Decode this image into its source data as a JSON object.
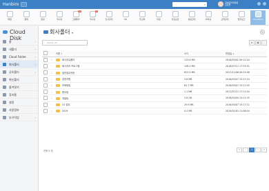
{
  "app": {
    "brand": "Hanbiro",
    "search_placeholder": "",
    "user_line1": "한비로마케팅팀",
    "user_line2": "김상철",
    "accent": "#3b7fc4"
  },
  "apps": [
    {
      "name": "app-mail",
      "label": "메일",
      "badge": ""
    },
    {
      "name": "app-approval",
      "label": "결재",
      "badge": ""
    },
    {
      "name": "app-calendar",
      "label": "일정",
      "badge": ""
    },
    {
      "name": "app-board",
      "label": "게시판",
      "badge": ""
    },
    {
      "name": "app-groupware",
      "label": "그룹웨어",
      "badge": "11"
    },
    {
      "name": "app-board2",
      "label": "게시판",
      "badge": "8"
    },
    {
      "name": "app-address",
      "label": "인사관리",
      "badge": ""
    },
    {
      "name": "app-hr",
      "label": "HR",
      "badge": ""
    },
    {
      "name": "app-task",
      "label": "주소록",
      "badge": ""
    },
    {
      "name": "app-meeting",
      "label": "미팅",
      "badge": ""
    },
    {
      "name": "app-archive",
      "label": "자료보관",
      "badge": ""
    },
    {
      "name": "app-survey",
      "label": "설문관리",
      "badge": ""
    },
    {
      "name": "app-reserve",
      "label": "회의실",
      "badge": ""
    },
    {
      "name": "app-timecard",
      "label": "근태관리",
      "badge": ""
    },
    {
      "name": "app-memo",
      "label": "업무보고",
      "badge": ""
    },
    {
      "name": "app-clouddisk",
      "label": "CloudDisk",
      "badge": ""
    }
  ],
  "sidebar": {
    "title": "Cloud Disk",
    "items": [
      {
        "label": "홈",
        "has_arrow": true
      },
      {
        "label": "내폴더",
        "has_arrow": true
      },
      {
        "label": "Cloud Folder",
        "has_arrow": true
      },
      {
        "label": "회사폴더",
        "has_arrow": true
      },
      {
        "label": "공유폴더",
        "has_arrow": true
      },
      {
        "label": "최신폴더",
        "has_arrow": false
      },
      {
        "label": "즐겨찾기",
        "has_arrow": false
      },
      {
        "label": "휴지통",
        "has_arrow": false
      },
      {
        "label": "설정",
        "has_arrow": false
      },
      {
        "label": "사용정보",
        "has_arrow": false
      },
      {
        "label": "부가작업",
        "has_arrow": true
      }
    ]
  },
  "main": {
    "title": "회사폴더",
    "search_placeholder": "Search All",
    "toolbar_icons": [
      "list-view",
      "grid-view",
      "menu"
    ],
    "columns": {
      "name": "이름 ↑",
      "size": "크기",
      "date": "변경일 ↓"
    },
    "rows": [
      {
        "name": "회사공유폴더",
        "size": "133.6 MB",
        "date": "2018/05/02 09:12:44"
      },
      {
        "name": "회사공지 프로그램",
        "size": "138.2 MB",
        "date": "2018/07/11 17:33:51"
      },
      {
        "name": "일반업무관련",
        "size": "823.5 MB",
        "date": "2017/11/06 09:25:58"
      },
      {
        "name": "경영지원",
        "size": "3.8 MB",
        "date": "2018/05/07 15:17:24"
      },
      {
        "name": "마케팅팀",
        "size": "82.7 MB",
        "date": "2018/05/07 15:17:45"
      },
      {
        "name": "총무팀",
        "size": "1.1 MB",
        "date": "2017/07/21 17:11:04"
      },
      {
        "name": "개발팀",
        "size": "2.8 GB",
        "date": "2018/05/04 15:11:35"
      },
      {
        "name": "CS 업무",
        "size": "29.9 MB",
        "date": "2018/05/07 15:17:11"
      },
      {
        "name": "2019",
        "size": "0.4 MB",
        "date": "2019/01/02 11:06:44"
      }
    ],
    "footer_count": "전체 9 개",
    "pager": [
      "«",
      "‹",
      "1",
      "›",
      "»"
    ],
    "current_page": "1"
  }
}
